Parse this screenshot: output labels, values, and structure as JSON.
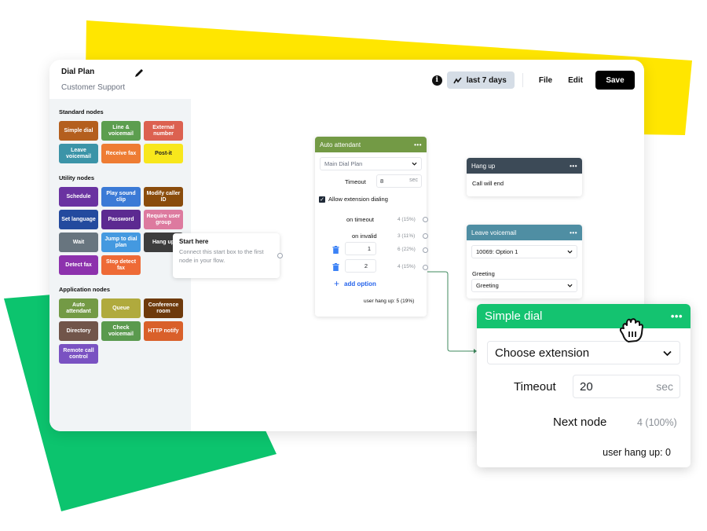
{
  "background": {
    "yellow": "#ffe600",
    "green": "#0cc46e"
  },
  "app": {
    "title": "Dial Plan",
    "subtitle": "Customer Support",
    "toolbar": {
      "info_icon": "info-icon",
      "range_label": "last 7 days",
      "file_label": "File",
      "edit_label": "Edit",
      "save_label": "Save"
    }
  },
  "sidebar": {
    "sections": [
      {
        "title": "Standard nodes",
        "items": [
          {
            "label": "Simple dial",
            "color": "#b45f1e"
          },
          {
            "label": "Line & voicemail",
            "color": "#5c9e4f"
          },
          {
            "label": "External number",
            "color": "#dc6150"
          },
          {
            "label": "Leave voicemail",
            "color": "#3b94a8"
          },
          {
            "label": "Receive fax",
            "color": "#ee7c33"
          },
          {
            "label": "Post-it",
            "color": "#f8e71c",
            "text_color": "#222222"
          }
        ]
      },
      {
        "title": "Utility nodes",
        "items": [
          {
            "label": "Schedule",
            "color": "#6a33a1"
          },
          {
            "label": "Play sound clip",
            "color": "#3b7ad6"
          },
          {
            "label": "Modify caller ID",
            "color": "#8a4c0c"
          },
          {
            "label": "Set language",
            "color": "#234a9e"
          },
          {
            "label": "Password",
            "color": "#5c2a91"
          },
          {
            "label": "Require user group",
            "color": "#dd7a9f"
          },
          {
            "label": "Wait",
            "color": "#68757f"
          },
          {
            "label": "Jump to dial plan",
            "color": "#4499e0"
          },
          {
            "label": "Hang up",
            "color": "#3d3d3d"
          },
          {
            "label": "Detect fax",
            "color": "#8d32ad"
          },
          {
            "label": "Stop detect fax",
            "color": "#ee6a36"
          }
        ]
      },
      {
        "title": "Application nodes",
        "items": [
          {
            "label": "Auto attendant",
            "color": "#739a45"
          },
          {
            "label": "Queue",
            "color": "#b0aa3d"
          },
          {
            "label": "Conference room",
            "color": "#6e3a0c"
          },
          {
            "label": "Directory",
            "color": "#71554a"
          },
          {
            "label": "Check voicemail",
            "color": "#5a9a4e"
          },
          {
            "label": "HTTP notify",
            "color": "#d9602a"
          },
          {
            "label": "Remote call control",
            "color": "#7a52c2"
          }
        ]
      }
    ]
  },
  "canvas": {
    "start": {
      "title": "Start here",
      "description": "Connect this start box to the first node in your flow."
    },
    "auto_attendant": {
      "title": "Auto attendant",
      "header_color": "#739a45",
      "menu": "Main Dial Plan",
      "timeout_label": "Timeout",
      "timeout_value": "8",
      "timeout_unit": "sec",
      "allow_ext_label": "Allow extension dialing",
      "allow_ext_checked": true,
      "rows": [
        {
          "label": "on timeout",
          "stat": "4 (15%)"
        },
        {
          "label": "on invalid",
          "stat": "3 (11%)"
        },
        {
          "option": "1",
          "stat": "6 (22%)"
        },
        {
          "option": "2",
          "stat": "4 (15%)"
        }
      ],
      "add_option_label": "add option",
      "hang_up_stat": "user hang up: 5 (19%)"
    },
    "hang_up": {
      "title": "Hang up",
      "header_color": "#3c4a57",
      "body": "Call will end"
    },
    "leave_voicemail": {
      "title": "Leave voicemail",
      "header_color": "#4f8ea3",
      "mailbox": "10069: Option 1",
      "greeting_label": "Greeting",
      "greeting_value": "Greeting"
    }
  },
  "simple_dial": {
    "title": "Simple dial",
    "header_color": "#14c370",
    "extension_placeholder": "Choose extension",
    "timeout_label": "Timeout",
    "timeout_value": "20",
    "timeout_unit": "sec",
    "next_node_label": "Next node",
    "next_node_stat": "4 (100%)",
    "hang_up_stat": "user hang up: 0"
  }
}
